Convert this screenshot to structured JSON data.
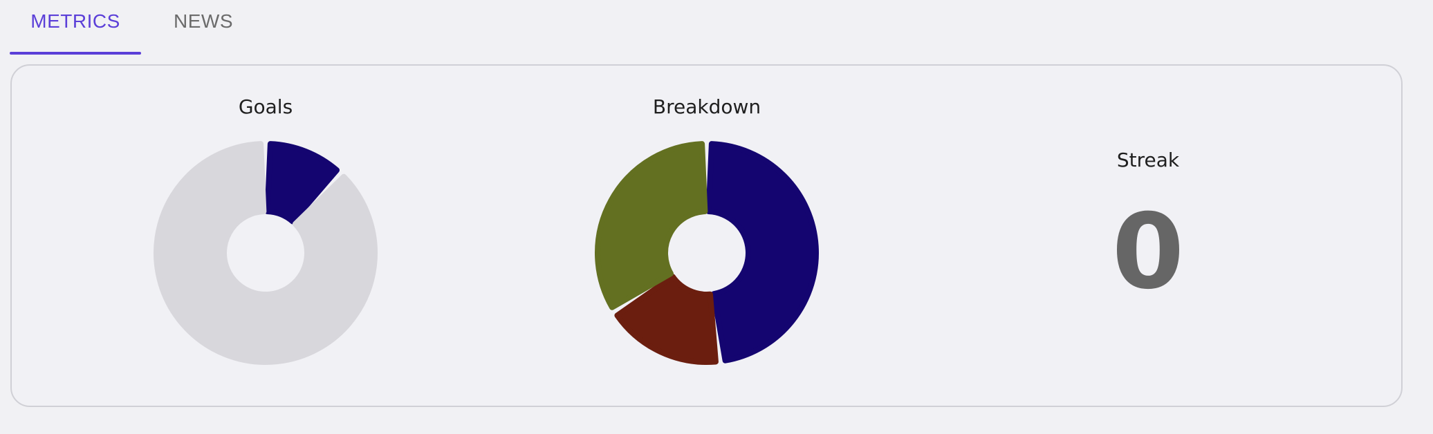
{
  "tabs": {
    "metrics_label": "METRICS",
    "news_label": "NEWS",
    "active": "METRICS",
    "accent_color": "#5b3fd8"
  },
  "goals": {
    "title": "Goals",
    "chart_data": {
      "type": "pie",
      "slices": [
        {
          "value": 12,
          "color": "#140570"
        },
        {
          "value": 88,
          "color": "#d8d7dc"
        }
      ]
    }
  },
  "breakdown": {
    "title": "Breakdown",
    "chart_data": {
      "type": "pie",
      "slices": [
        {
          "value": 48,
          "color": "#140570"
        },
        {
          "value": 18,
          "color": "#6b1e0f"
        },
        {
          "value": 34,
          "color": "#637021"
        }
      ]
    }
  },
  "streak": {
    "title": "Streak",
    "value": "0"
  }
}
